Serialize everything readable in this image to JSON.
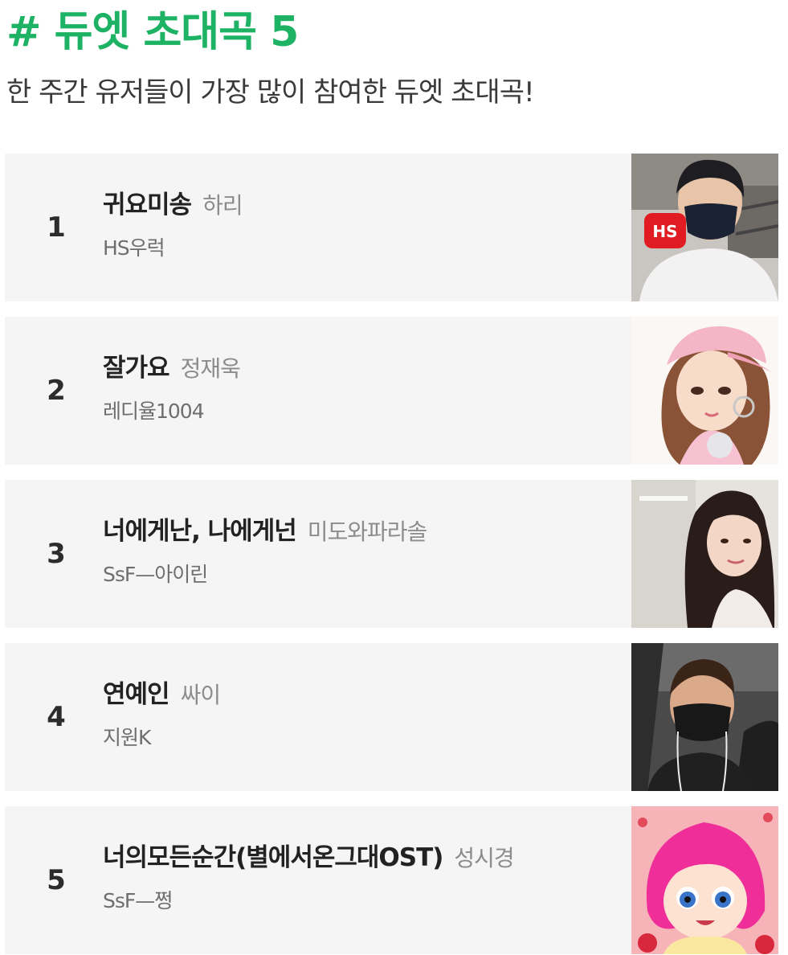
{
  "header": {
    "title": "# 듀엣 초대곡 5",
    "subtitle": "한 주간 유저들이 가장 많이 참여한 듀엣 초대곡!"
  },
  "items": [
    {
      "rank": "1",
      "title": "귀요미송",
      "artist": "하리",
      "singer": "HS우럭",
      "thumb_icon": "selfie-man-mask-photo"
    },
    {
      "rank": "2",
      "title": "잘가요",
      "artist": "정재욱",
      "singer": "레디율1004",
      "thumb_icon": "illustrated-girl-pink-cap"
    },
    {
      "rank": "3",
      "title": "너에게난, 나에게넌",
      "artist": "미도와파라솔",
      "singer": "SsF—아이린",
      "thumb_icon": "woman-selfie-photo"
    },
    {
      "rank": "4",
      "title": "연예인",
      "artist": "싸이",
      "singer": "지원K",
      "thumb_icon": "man-in-car-mask-photo"
    },
    {
      "rank": "5",
      "title": "너의모든순간(별에서온그대OST)",
      "artist": "성시경",
      "singer": "SsF—쩡",
      "thumb_icon": "cartoon-pink-hair-girl"
    }
  ],
  "colors": {
    "accent": "#1db264",
    "row_background": "#f5f5f5"
  }
}
